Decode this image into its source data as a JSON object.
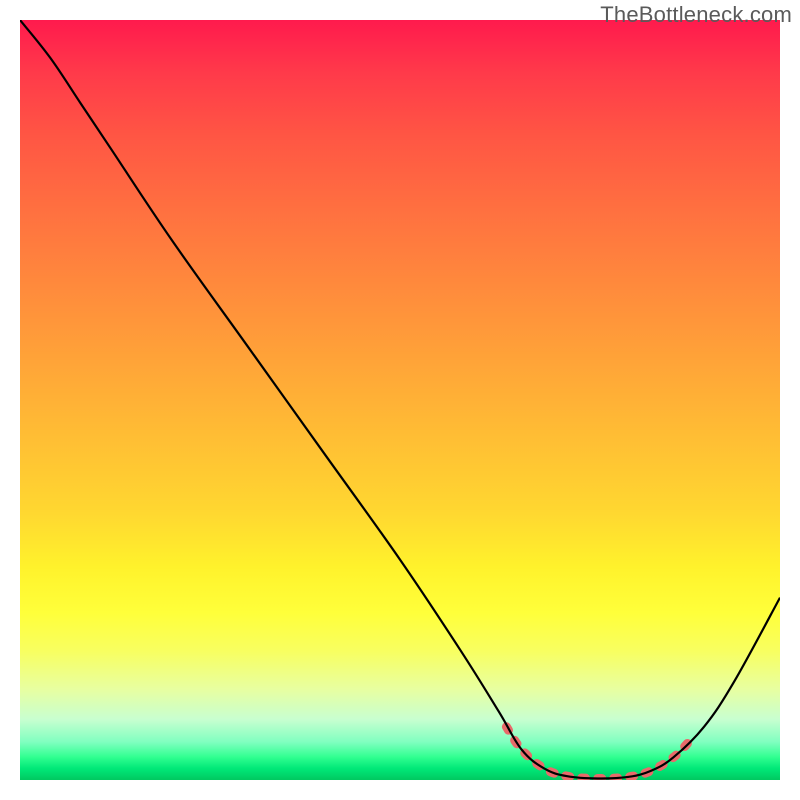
{
  "watermark": "TheBottleneck.com",
  "chart_data": {
    "type": "line",
    "title": "",
    "xlabel": "",
    "ylabel": "",
    "xlim": [
      0,
      100
    ],
    "ylim": [
      0,
      100
    ],
    "series": [
      {
        "name": "bottleneck-curve",
        "color": "#000000",
        "stroke_width": 2,
        "points": [
          {
            "x": 0,
            "y": 100
          },
          {
            "x": 4,
            "y": 95
          },
          {
            "x": 8,
            "y": 89
          },
          {
            "x": 12,
            "y": 83
          },
          {
            "x": 20,
            "y": 71
          },
          {
            "x": 30,
            "y": 57
          },
          {
            "x": 40,
            "y": 43
          },
          {
            "x": 50,
            "y": 29
          },
          {
            "x": 58,
            "y": 17
          },
          {
            "x": 63,
            "y": 9
          },
          {
            "x": 66,
            "y": 4
          },
          {
            "x": 69,
            "y": 1.5
          },
          {
            "x": 72,
            "y": 0.5
          },
          {
            "x": 76,
            "y": 0.2
          },
          {
            "x": 80,
            "y": 0.4
          },
          {
            "x": 83,
            "y": 1.2
          },
          {
            "x": 86,
            "y": 3
          },
          {
            "x": 90,
            "y": 7
          },
          {
            "x": 94,
            "y": 13
          },
          {
            "x": 100,
            "y": 24
          }
        ]
      },
      {
        "name": "optimal-highlight",
        "color": "#e86a6a",
        "stroke_width": 8,
        "dashed": true,
        "points": [
          {
            "x": 64,
            "y": 7
          },
          {
            "x": 66,
            "y": 4
          },
          {
            "x": 69,
            "y": 1.5
          },
          {
            "x": 72,
            "y": 0.5
          },
          {
            "x": 76,
            "y": 0.2
          },
          {
            "x": 80,
            "y": 0.4
          },
          {
            "x": 83,
            "y": 1.2
          },
          {
            "x": 86,
            "y": 3
          },
          {
            "x": 88,
            "y": 5
          }
        ]
      }
    ]
  }
}
